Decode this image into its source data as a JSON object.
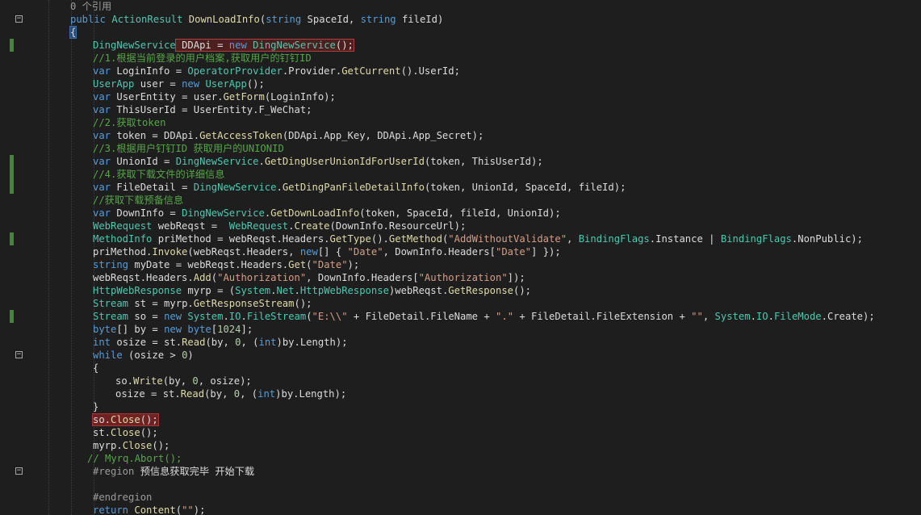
{
  "editor": {
    "references_label": "0 个引用",
    "lines": [
      {
        "text": "public ActionResult DownLoadInfo(string SpaceId, string fileId)"
      },
      {
        "text": "{"
      },
      {
        "text": "DingNewService DDApi = new DingNewService();"
      },
      {
        "text": "//1.根据当前登录的用户档案,获取用户的钉钉ID"
      },
      {
        "text": "var LoginInfo = OperatorProvider.Provider.GetCurrent().UserId;"
      },
      {
        "text": "UserApp user = new UserApp();"
      },
      {
        "text": "var UserEntity = user.GetForm(LoginInfo);"
      },
      {
        "text": "var ThisUserId = UserEntity.F_WeChat;"
      },
      {
        "text": "//2.获取token"
      },
      {
        "text": "var token = DDApi.GetAccessToken(DDApi.App_Key, DDApi.App_Secret);"
      },
      {
        "text": "//3.根据用户钉钉ID 获取用户的UNIONID"
      },
      {
        "text": "var UnionId = DingNewService.GetDingUserUnionIdForUserId(token, ThisUserId);"
      },
      {
        "text": "//4.获取下载文件的详细信息"
      },
      {
        "text": "var FileDetail = DingNewService.GetDingPanFileDetailInfo(token, UnionId, SpaceId, fileId);"
      },
      {
        "text": "//获取下载预备信息"
      },
      {
        "text": "var DownInfo = DingNewService.GetDownLoadInfo(token, SpaceId, fileId, UnionId);"
      },
      {
        "text": "WebRequest webReqst =  WebRequest.Create(DownInfo.ResourceUrl);"
      },
      {
        "text": "MethodInfo priMethod = webReqst.Headers.GetType().GetMethod(\"AddWithoutValidate\", BindingFlags.Instance | BindingFlags.NonPublic);"
      },
      {
        "text": "priMethod.Invoke(webReqst.Headers, new[] { \"Date\", DownInfo.Headers[\"Date\"] });"
      },
      {
        "text": "string myDate = webReqst.Headers.Get(\"Date\");"
      },
      {
        "text": "webReqst.Headers.Add(\"Authorization\", DownInfo.Headers[\"Authorization\"]);"
      },
      {
        "text": "HttpWebResponse myrp = (System.Net.HttpWebResponse)webReqst.GetResponse();"
      },
      {
        "text": "Stream st = myrp.GetResponseStream();"
      },
      {
        "text": "Stream so = new System.IO.FileStream(\"E:\\\\\" + FileDetail.FileName + \".\" + FileDetail.FileExtension + \"\", System.IO.FileMode.Create);"
      },
      {
        "text": "byte[] by = new byte[1024];"
      },
      {
        "text": "int osize = st.Read(by, 0, (int)by.Length);"
      },
      {
        "text": "while (osize > 0)"
      },
      {
        "text": "{"
      },
      {
        "text": "so.Write(by, 0, osize);"
      },
      {
        "text": "osize = st.Read(by, 0, (int)by.Length);"
      },
      {
        "text": "}"
      },
      {
        "text": "so.Close();"
      },
      {
        "text": "st.Close();"
      },
      {
        "text": "myrp.Close();"
      },
      {
        "text": "// Myrq.Abort();"
      },
      {
        "text": "#region 预信息获取完毕 开始下载"
      },
      {
        "text": ""
      },
      {
        "text": "#endregion"
      },
      {
        "text": "return Content(\"\");"
      }
    ]
  },
  "colors": {
    "background": "#1e1e1e",
    "keyword": "#569cd6",
    "type": "#4ec9b0",
    "method": "#dcdcaa",
    "string": "#d69d85",
    "comment": "#57a64a",
    "number": "#b5cea8",
    "change_marker": "#57a64a",
    "error_highlight": "#6e2222"
  }
}
